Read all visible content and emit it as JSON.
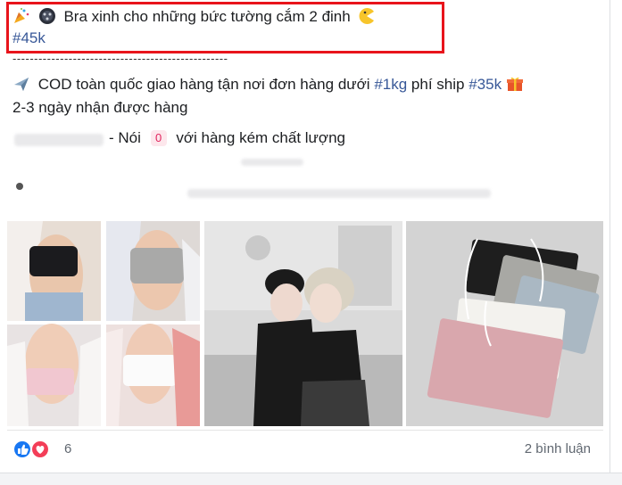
{
  "post": {
    "title_text": "Bra xinh cho những bức tường cắm 2 đinh",
    "title_hashtag": "#45k",
    "divider": "--------------------------------------------------",
    "shipping_prefix": "COD toàn quốc giao hàng tận nơi đơn hàng dưới",
    "shipping_weight_tag": "#1kg",
    "shipping_mid": "phí ship",
    "shipping_fee_tag": "#35k",
    "delivery_time": "2-3 ngày nhận được hàng",
    "quality_text": "- Nói",
    "quality_badge": "0",
    "quality_suffix": "với hàng kém chất lượng"
  },
  "footer": {
    "reaction_count": "6",
    "comments_label": "2 bình luận"
  },
  "colors": {
    "highlight_border": "#e8141b",
    "hashtag": "#385898",
    "like_blue": "#1877f2",
    "love_red": "#f33e58"
  },
  "icons": [
    "party-popper-icon",
    "film-reel-icon",
    "pacman-icon",
    "airplane-icon",
    "gift-icon",
    "like-reaction-icon",
    "love-reaction-icon"
  ]
}
